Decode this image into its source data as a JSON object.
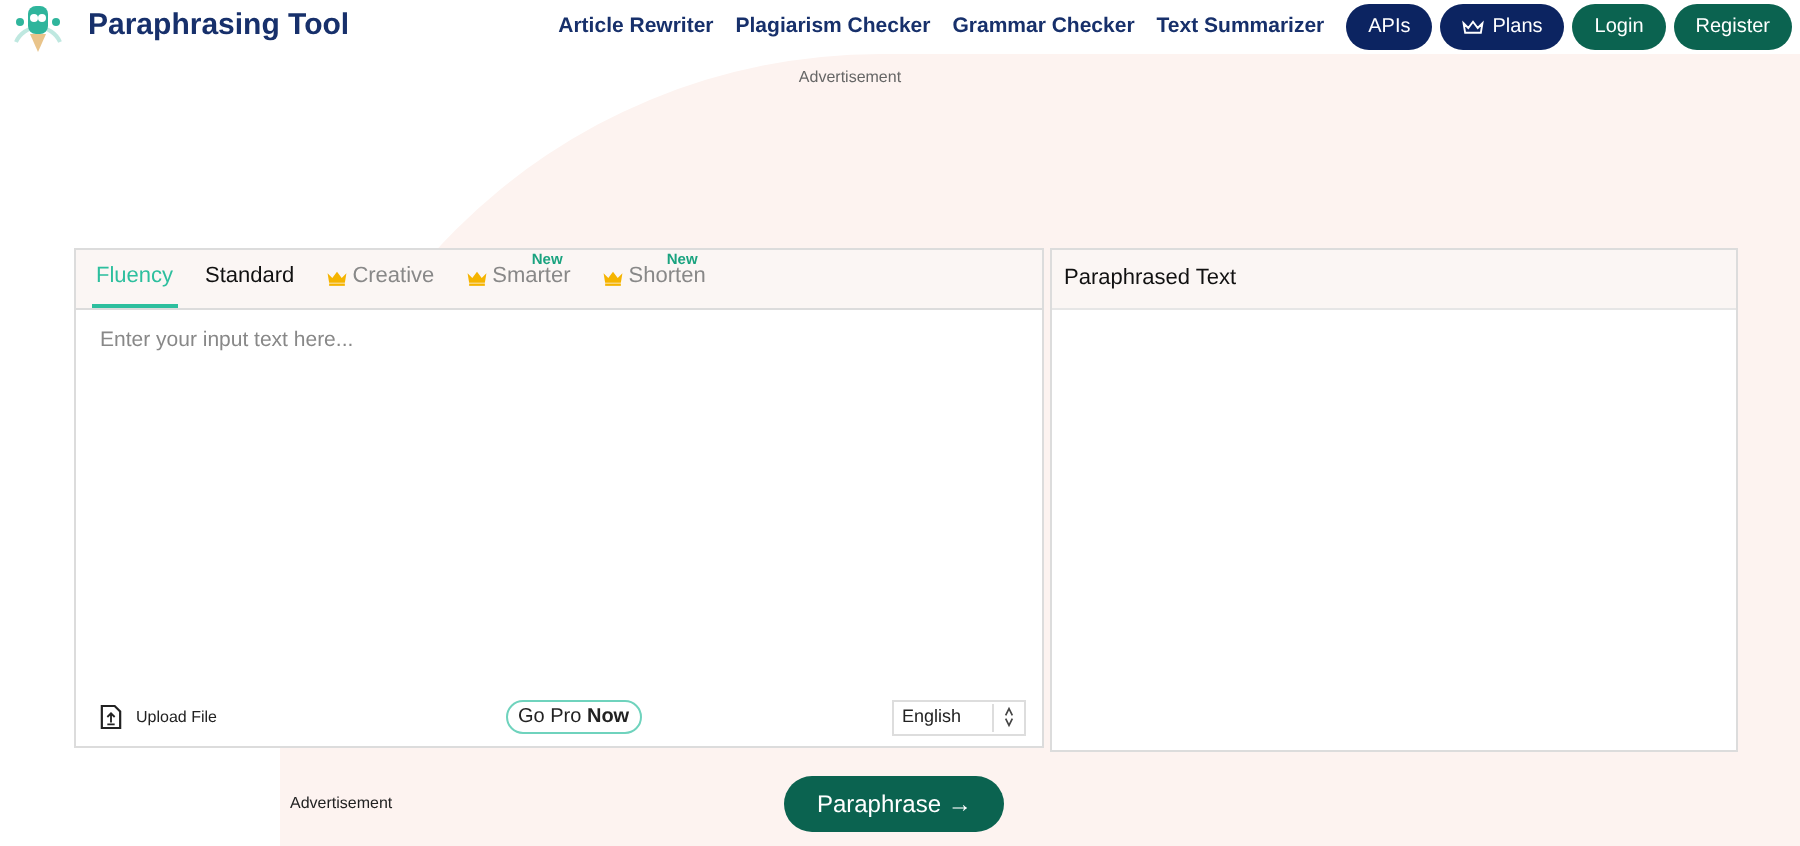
{
  "header": {
    "brand": "Paraphrasing Tool",
    "nav": [
      "Article Rewriter",
      "Plagiarism Checker",
      "Grammar Checker",
      "Text Summarizer"
    ],
    "buttons": [
      {
        "label": "APIs",
        "kind": "dark"
      },
      {
        "label": "Plans",
        "kind": "dark-crown"
      },
      {
        "label": "Login",
        "kind": "green"
      },
      {
        "label": "Register",
        "kind": "green"
      }
    ]
  },
  "top_ad": "Advertisement",
  "editor": {
    "tabs": [
      {
        "label": "Fluency",
        "selected": true,
        "kind": "free"
      },
      {
        "label": "Standard",
        "selected": false,
        "kind": "free"
      },
      {
        "label": "Creative",
        "selected": false,
        "kind": "premium"
      },
      {
        "label": "Smarter",
        "selected": false,
        "kind": "premium",
        "badge": "New"
      },
      {
        "label": "Shorten",
        "selected": false,
        "kind": "premium",
        "badge": "New"
      }
    ],
    "placeholder": "Enter your input text here...",
    "upload": "Upload File",
    "go_pro": "Go Pro **Now**",
    "language": "English"
  },
  "output": {
    "title": "Paraphrased Text"
  },
  "bottom_ad": "Advertisement",
  "action": "Paraphrase →"
}
